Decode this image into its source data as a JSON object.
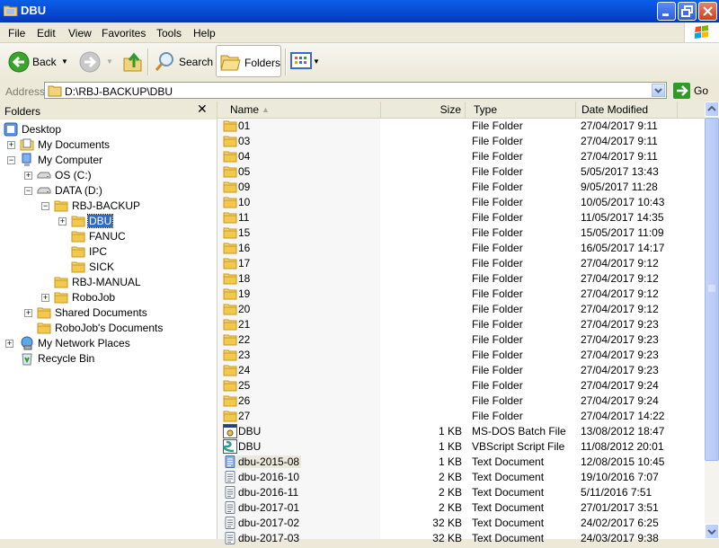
{
  "window": {
    "title": "DBU"
  },
  "menu": [
    "File",
    "Edit",
    "View",
    "Favorites",
    "Tools",
    "Help"
  ],
  "toolbar": {
    "back_label": "Back",
    "search_label": "Search",
    "folders_label": "Folders"
  },
  "address": {
    "label": "Address",
    "value": "D:\\RBJ-BACKUP\\DBU",
    "go_label": "Go"
  },
  "folder_pane": {
    "title": "Folders",
    "close_glyph": "✕",
    "tree": [
      {
        "label": "Desktop",
        "icon": "desktop-icon",
        "level": 0,
        "expander": ""
      },
      {
        "label": "My Documents",
        "icon": "my-documents-icon",
        "level": 1,
        "expander": "+"
      },
      {
        "label": "My Computer",
        "icon": "my-computer-icon",
        "level": 1,
        "expander": "−"
      },
      {
        "label": "OS (C:)",
        "icon": "drive-icon",
        "level": 2,
        "expander": "+"
      },
      {
        "label": "DATA (D:)",
        "icon": "drive-icon",
        "level": 2,
        "expander": "−"
      },
      {
        "label": "RBJ-BACKUP",
        "icon": "folder-icon",
        "level": 3,
        "expander": "−"
      },
      {
        "label": "DBU",
        "icon": "folder-icon",
        "level": 4,
        "expander": "+",
        "selected": true
      },
      {
        "label": "FANUC",
        "icon": "folder-icon",
        "level": 4,
        "expander": ""
      },
      {
        "label": "IPC",
        "icon": "folder-icon",
        "level": 4,
        "expander": ""
      },
      {
        "label": "SICK",
        "icon": "folder-icon",
        "level": 4,
        "expander": ""
      },
      {
        "label": "RBJ-MANUAL",
        "icon": "folder-icon",
        "level": 3,
        "expander": ""
      },
      {
        "label": "RoboJob",
        "icon": "folder-icon",
        "level": 3,
        "expander": "+"
      },
      {
        "label": "Shared Documents",
        "icon": "folder-icon",
        "level": 2,
        "expander": "+"
      },
      {
        "label": "RoboJob's Documents",
        "icon": "folder-icon",
        "level": 2,
        "expander": ""
      },
      {
        "label": "My Network Places",
        "icon": "network-icon",
        "level": 0,
        "expander": "+"
      },
      {
        "label": "Recycle Bin",
        "icon": "recycle-bin-icon",
        "level": 0,
        "expander": ""
      }
    ]
  },
  "list": {
    "columns": {
      "name": "Name",
      "size": "Size",
      "type": "Type",
      "date": "Date Modified"
    },
    "sort_indicator": "▲",
    "rows": [
      {
        "name": "01",
        "size": "",
        "type": "File Folder",
        "date": "27/04/2017 9:11",
        "icon": "folder"
      },
      {
        "name": "03",
        "size": "",
        "type": "File Folder",
        "date": "27/04/2017 9:11",
        "icon": "folder"
      },
      {
        "name": "04",
        "size": "",
        "type": "File Folder",
        "date": "27/04/2017 9:11",
        "icon": "folder"
      },
      {
        "name": "05",
        "size": "",
        "type": "File Folder",
        "date": "5/05/2017 13:43",
        "icon": "folder"
      },
      {
        "name": "09",
        "size": "",
        "type": "File Folder",
        "date": "9/05/2017 11:28",
        "icon": "folder"
      },
      {
        "name": "10",
        "size": "",
        "type": "File Folder",
        "date": "10/05/2017 10:43",
        "icon": "folder"
      },
      {
        "name": "11",
        "size": "",
        "type": "File Folder",
        "date": "11/05/2017 14:35",
        "icon": "folder"
      },
      {
        "name": "15",
        "size": "",
        "type": "File Folder",
        "date": "15/05/2017 11:09",
        "icon": "folder"
      },
      {
        "name": "16",
        "size": "",
        "type": "File Folder",
        "date": "16/05/2017 14:17",
        "icon": "folder"
      },
      {
        "name": "17",
        "size": "",
        "type": "File Folder",
        "date": "27/04/2017 9:12",
        "icon": "folder"
      },
      {
        "name": "18",
        "size": "",
        "type": "File Folder",
        "date": "27/04/2017 9:12",
        "icon": "folder"
      },
      {
        "name": "19",
        "size": "",
        "type": "File Folder",
        "date": "27/04/2017 9:12",
        "icon": "folder"
      },
      {
        "name": "20",
        "size": "",
        "type": "File Folder",
        "date": "27/04/2017 9:12",
        "icon": "folder"
      },
      {
        "name": "21",
        "size": "",
        "type": "File Folder",
        "date": "27/04/2017 9:23",
        "icon": "folder"
      },
      {
        "name": "22",
        "size": "",
        "type": "File Folder",
        "date": "27/04/2017 9:23",
        "icon": "folder"
      },
      {
        "name": "23",
        "size": "",
        "type": "File Folder",
        "date": "27/04/2017 9:23",
        "icon": "folder"
      },
      {
        "name": "24",
        "size": "",
        "type": "File Folder",
        "date": "27/04/2017 9:23",
        "icon": "folder"
      },
      {
        "name": "25",
        "size": "",
        "type": "File Folder",
        "date": "27/04/2017 9:24",
        "icon": "folder"
      },
      {
        "name": "26",
        "size": "",
        "type": "File Folder",
        "date": "27/04/2017 9:24",
        "icon": "folder"
      },
      {
        "name": "27",
        "size": "",
        "type": "File Folder",
        "date": "27/04/2017 14:22",
        "icon": "folder"
      },
      {
        "name": "DBU",
        "size": "1 KB",
        "type": "MS-DOS Batch File",
        "date": "13/08/2012 18:47",
        "icon": "batch"
      },
      {
        "name": "DBU",
        "size": "1 KB",
        "type": "VBScript Script File",
        "date": "11/08/2012 20:01",
        "icon": "vbscript"
      },
      {
        "name": "dbu-2015-08",
        "size": "1 KB",
        "type": "Text Document",
        "date": "12/08/2015 10:45",
        "icon": "text",
        "hover": true
      },
      {
        "name": "dbu-2016-10",
        "size": "2 KB",
        "type": "Text Document",
        "date": "19/10/2016 7:07",
        "icon": "text"
      },
      {
        "name": "dbu-2016-11",
        "size": "2 KB",
        "type": "Text Document",
        "date": "5/11/2016 7:51",
        "icon": "text"
      },
      {
        "name": "dbu-2017-01",
        "size": "2 KB",
        "type": "Text Document",
        "date": "27/01/2017 3:51",
        "icon": "text"
      },
      {
        "name": "dbu-2017-02",
        "size": "32 KB",
        "type": "Text Document",
        "date": "24/02/2017 6:25",
        "icon": "text"
      },
      {
        "name": "dbu-2017-03",
        "size": "32 KB",
        "type": "Text Document",
        "date": "24/03/2017 9:38",
        "icon": "text"
      }
    ]
  }
}
